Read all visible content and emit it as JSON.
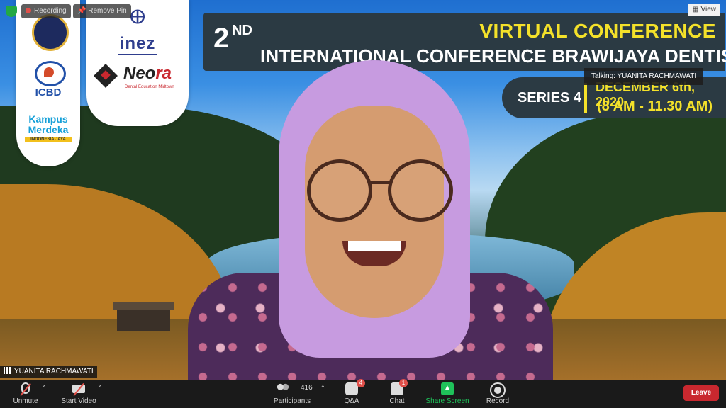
{
  "top_bar": {
    "recording_label": "Recording",
    "remove_pin_label": "Remove Pin",
    "view_label": "View"
  },
  "logos": {
    "icbd": "ICBD",
    "kampus_line1": "Kampus",
    "kampus_line2": "Merdeka",
    "kampus_line3": "INDONESIA JAYA",
    "inez": "inez",
    "neora_main": "Neo",
    "neora_r": "ra",
    "neora_sub": "Dental Education Midtown"
  },
  "banner": {
    "number": "2",
    "suffix": "ND",
    "virtual_conference": "VIRTUAL CONFERENCE",
    "conference_name": "INTERNATIONAL CONFERENCE BRAWIJAYA DENTISTRY (ICBD)",
    "series": "SERIES 4",
    "date": "DECEMBER 6th, 2020",
    "time": "(8 AM - 11.30 AM)"
  },
  "talking_indicator": "Talking: YUANITA RACHMAWATI",
  "name_tag": "YUANITA RACHMAWATI",
  "toolbar": {
    "unmute": "Unmute",
    "start_video": "Start Video",
    "participants": "Participants",
    "participants_count": "416",
    "qa": "Q&A",
    "qa_badge": "4",
    "chat": "Chat",
    "chat_badge": "1",
    "share_screen": "Share Screen",
    "record": "Record",
    "leave": "Leave"
  },
  "colors": {
    "banner_bg": "#2b3a43",
    "banner_accent": "#f4e12a",
    "share_green": "#1fc35a",
    "leave_red": "#c9282f",
    "toolbar_bg": "#1a1a1a"
  }
}
